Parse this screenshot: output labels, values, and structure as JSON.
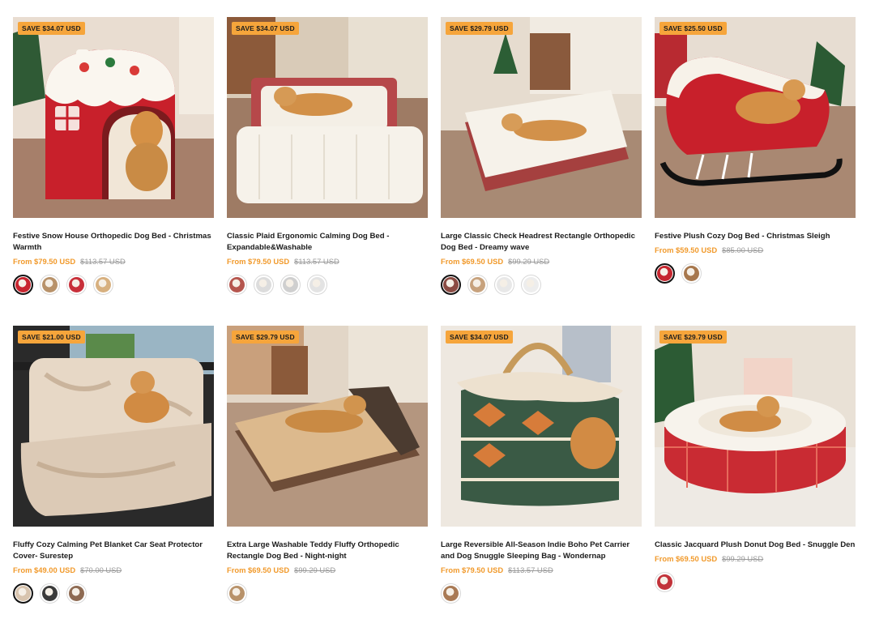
{
  "products": [
    {
      "badge": "SAVE $34.07 USD",
      "title": "Festive Snow House Orthopedic Dog Bed - Christmas Warmth",
      "price": "From $79.50 USD",
      "compare": "$113.57 USD",
      "swatches": [
        {
          "color": "#c7252f",
          "selected": true
        },
        {
          "color": "#b8926a",
          "selected": false
        },
        {
          "color": "#c8303a",
          "selected": false
        },
        {
          "color": "#d7b07f",
          "selected": false
        }
      ]
    },
    {
      "badge": "SAVE $34.07 USD",
      "title": "Classic Plaid Ergonomic Calming Dog Bed - Expandable&Washable",
      "price": "From $79.50 USD",
      "compare": "$113.57 USD",
      "swatches": [
        {
          "color": "#b5564e",
          "selected": false
        },
        {
          "color": "#dcdcdc",
          "selected": false
        },
        {
          "color": "#cfcfcf",
          "selected": false
        },
        {
          "color": "#e3e3e3",
          "selected": false
        }
      ]
    },
    {
      "badge": "SAVE $29.79 USD",
      "title": "Large Classic Check Headrest Rectangle Orthopedic Dog Bed - Dreamy wave",
      "price": "From $69.50 USD",
      "compare": "$99.29 USD",
      "swatches": [
        {
          "color": "#8b4b43",
          "selected": true
        },
        {
          "color": "#c7a27d",
          "selected": false
        },
        {
          "color": "#e8e8e8",
          "selected": false
        },
        {
          "color": "#ededed",
          "selected": false
        }
      ]
    },
    {
      "badge": "SAVE $25.50 USD",
      "title": "Festive Plush Cozy Dog Bed - Christmas Sleigh",
      "price": "From $59.50 USD",
      "compare": "$85.00 USD",
      "swatches": [
        {
          "color": "#c5252e",
          "selected": true
        },
        {
          "color": "#a7774d",
          "selected": false
        }
      ]
    },
    {
      "badge": "SAVE $21.00 USD",
      "title": "Fluffy Cozy Calming Pet Blanket Car Seat Protector Cover- Surestep",
      "price": "From $49.00 USD",
      "compare": "$70.00 USD",
      "swatches": [
        {
          "color": "#d8c4ae",
          "selected": true
        },
        {
          "color": "#3a3a3a",
          "selected": false
        },
        {
          "color": "#8e6a52",
          "selected": false
        }
      ]
    },
    {
      "badge": "SAVE $29.79 USD",
      "title": "Extra Large Washable Teddy Fluffy Orthopedic Rectangle Dog Bed - Night-night",
      "price": "From $69.50 USD",
      "compare": "$99.29 USD",
      "swatches": [
        {
          "color": "#b8926a",
          "selected": false
        }
      ]
    },
    {
      "badge": "SAVE $34.07 USD",
      "title": "Large Reversible All-Season Indie Boho Pet Carrier and Dog Snuggle Sleeping Bag - Wondernap",
      "price": "From $79.50 USD",
      "compare": "$113.57 USD",
      "swatches": [
        {
          "color": "#a97a55",
          "selected": false
        }
      ]
    },
    {
      "badge": "SAVE $29.79 USD",
      "title": "Classic Jacquard Plush Donut Dog Bed - Snuggle Den",
      "price": "From $69.50 USD",
      "compare": "$99.29 USD",
      "swatches": [
        {
          "color": "#c2333a",
          "selected": false
        }
      ]
    }
  ],
  "colors": {
    "badge_bg": "#f6a53b",
    "price_accent": "#f19a2c",
    "compare_price": "#9a9a9a"
  }
}
